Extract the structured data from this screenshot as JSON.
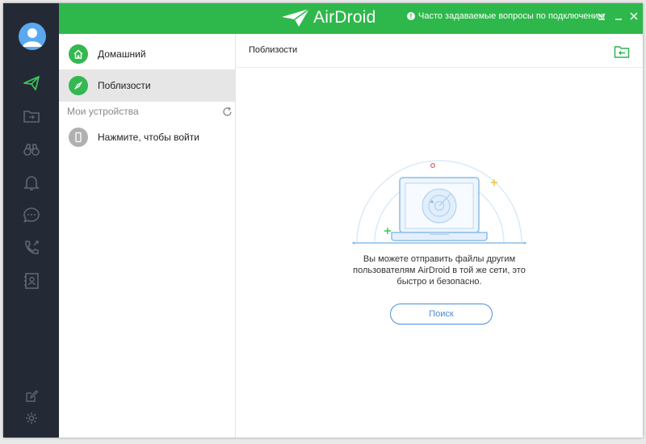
{
  "app": {
    "logo_text": "AirDroid"
  },
  "topbar": {
    "faq_label": "Часто задаваемые вопросы по подключению"
  },
  "sidebar": {
    "items": [
      {
        "label": "Домашний"
      },
      {
        "label": "Поблизости"
      }
    ],
    "section_title": "Мои устройства",
    "device_item": {
      "label": "Нажмите, чтобы войти"
    }
  },
  "rail": {
    "icons": [
      "send-icon",
      "file-transfer-icon",
      "binoculars-icon",
      "bell-icon",
      "chat-icon",
      "call-icon",
      "contacts-icon",
      "edit-icon",
      "settings-icon"
    ]
  },
  "main": {
    "title": "Поблизости",
    "description_lines": [
      "Вы можете отправить файлы другим",
      "пользователям AirDroid в той же сети, это",
      "быстро и безопасно."
    ],
    "search_button": "Поиск"
  },
  "colors": {
    "accent": "#2eb84b",
    "rail": "#242a35",
    "link": "#4a8bd4"
  }
}
